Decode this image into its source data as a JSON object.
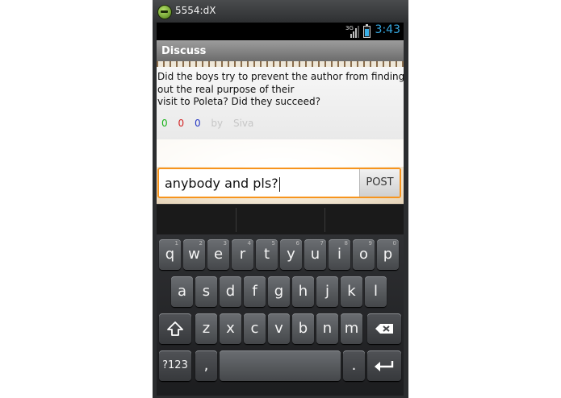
{
  "window": {
    "title": "5554:dX"
  },
  "status": {
    "network": "3G",
    "time": "3:43",
    "battery_level": 0.7,
    "signal_level": 0.75,
    "accent_color": "#36a8e0"
  },
  "header": {
    "title": "Discuss"
  },
  "question": {
    "lines": [
      "Did the boys try to prevent the author from finding",
      "out the real purpose of their",
      "visit to Poleta? Did they succeed?"
    ],
    "up_votes": "0",
    "down_votes": "0",
    "neutral_votes": "0",
    "by_label": "by",
    "author": "Siva"
  },
  "composer": {
    "value": "anybody and pls?",
    "post_label": "POST",
    "accent_color": "#f7941d"
  },
  "keyboard": {
    "row1": [
      {
        "label": "q",
        "hint": "1"
      },
      {
        "label": "w",
        "hint": "2"
      },
      {
        "label": "e",
        "hint": "3"
      },
      {
        "label": "r",
        "hint": "4"
      },
      {
        "label": "t",
        "hint": "5"
      },
      {
        "label": "y",
        "hint": "6"
      },
      {
        "label": "u",
        "hint": "7"
      },
      {
        "label": "i",
        "hint": "8"
      },
      {
        "label": "o",
        "hint": "9"
      },
      {
        "label": "p",
        "hint": "0"
      }
    ],
    "row2": [
      "a",
      "s",
      "d",
      "f",
      "g",
      "h",
      "j",
      "k",
      "l"
    ],
    "row3": [
      "z",
      "x",
      "c",
      "v",
      "b",
      "n",
      "m"
    ],
    "symbols_label": "?123",
    "comma_label": ",",
    "period_label": ".",
    "icons": {
      "shift": "shift-arrow-icon",
      "delete": "backspace-icon",
      "enter": "enter-arrow-icon"
    }
  }
}
